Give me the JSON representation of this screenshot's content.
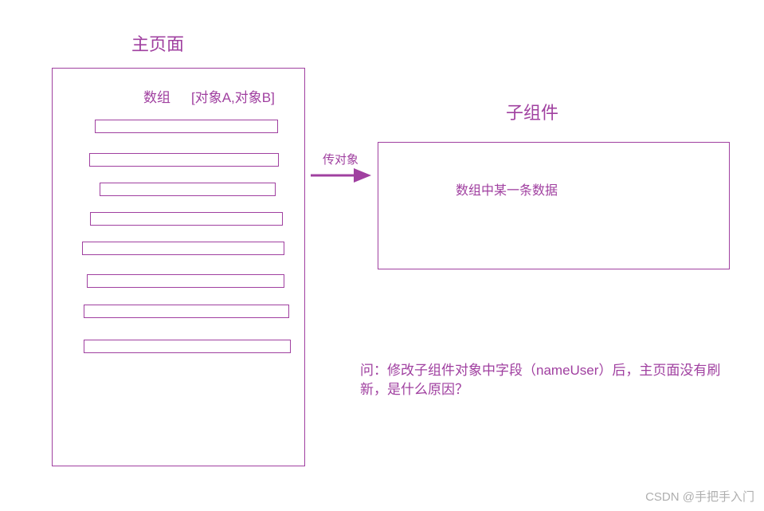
{
  "main_page": {
    "title": "主页面",
    "array_label": "数组",
    "array_content": "[对象A,对象B]"
  },
  "child_component": {
    "title": "子组件",
    "content": "数组中某一条数据"
  },
  "arrow": {
    "label": "传对象"
  },
  "question": {
    "text": "问：修改子组件对象中字段（nameUser）后，主页面没有刷新，是什么原因？"
  },
  "watermark": "CSDN @手把手入门"
}
